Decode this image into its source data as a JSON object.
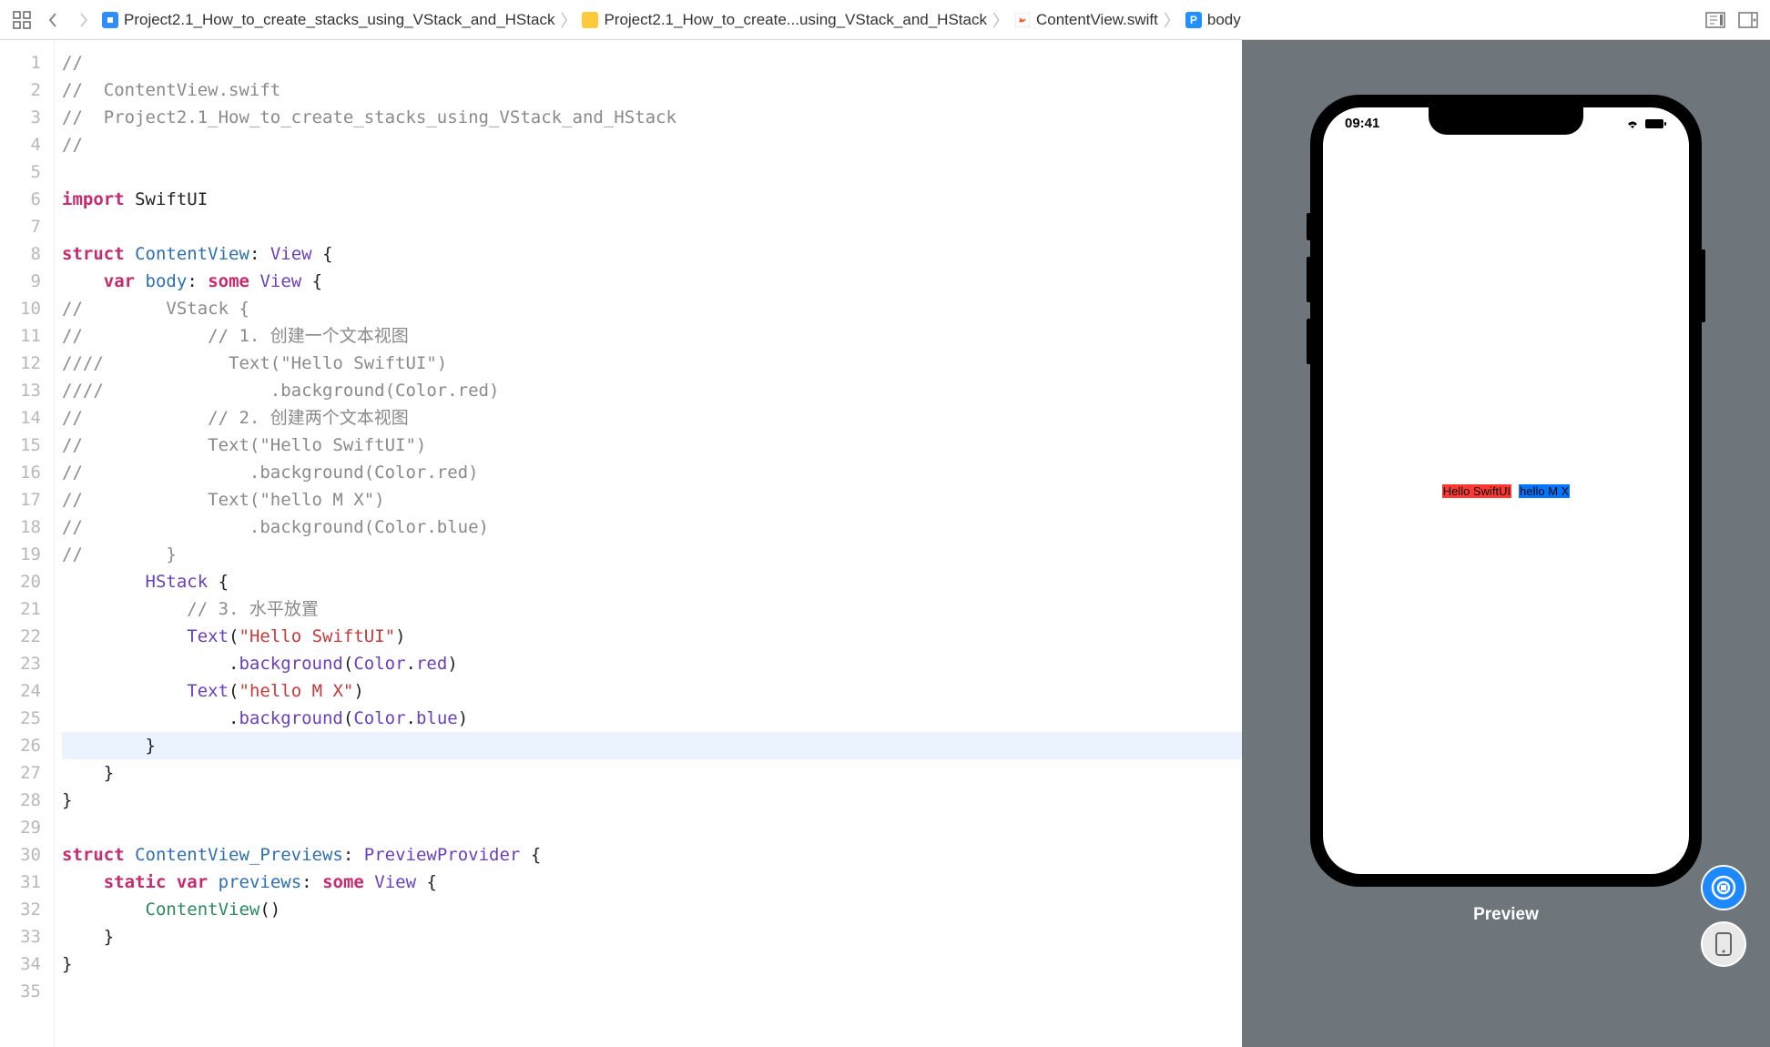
{
  "toolbar": {
    "breadcrumb": [
      {
        "icon": "project",
        "label": "Project2.1_How_to_create_stacks_using_VStack_and_HStack"
      },
      {
        "icon": "folder",
        "label": "Project2.1_How_to_create...using_VStack_and_HStack"
      },
      {
        "icon": "swift",
        "label": "ContentView.swift"
      },
      {
        "icon": "prop",
        "label": "body"
      }
    ]
  },
  "code": {
    "lines": [
      {
        "n": 1,
        "html": "<span class='c-comment'>//</span>"
      },
      {
        "n": 2,
        "html": "<span class='c-comment'>//  ContentView.swift</span>"
      },
      {
        "n": 3,
        "html": "<span class='c-comment'>//  Project2.1_How_to_create_stacks_using_VStack_and_HStack</span>"
      },
      {
        "n": 4,
        "html": "<span class='c-comment'>//</span>"
      },
      {
        "n": 5,
        "html": ""
      },
      {
        "n": 6,
        "html": "<span class='c-keyword'>import</span> <span class='c-plain'>SwiftUI</span>"
      },
      {
        "n": 7,
        "html": ""
      },
      {
        "n": 8,
        "html": "<span class='c-keyword'>struct</span> <span class='c-id'>ContentView</span><span class='c-plain'>:</span> <span class='c-type'>View</span> <span class='c-plain'>{</span>"
      },
      {
        "n": 9,
        "html": "    <span class='c-keyword'>var</span> <span class='c-id'>body</span><span class='c-plain'>:</span> <span class='c-keyword'>some</span> <span class='c-type'>View</span> <span class='c-plain'>{</span>"
      },
      {
        "n": 10,
        "html": "<span class='c-comment'>//        VStack {</span>"
      },
      {
        "n": 11,
        "html": "<span class='c-comment'>//            // 1. 创建一个文本视图</span>"
      },
      {
        "n": 12,
        "html": "<span class='c-comment'>////            Text(\"Hello SwiftUI\")</span>"
      },
      {
        "n": 13,
        "html": "<span class='c-comment'>////                .background(Color.red)</span>"
      },
      {
        "n": 14,
        "html": "<span class='c-comment'>//            // 2. 创建两个文本视图</span>"
      },
      {
        "n": 15,
        "html": "<span class='c-comment'>//            Text(\"Hello SwiftUI\")</span>"
      },
      {
        "n": 16,
        "html": "<span class='c-comment'>//                .background(Color.red)</span>"
      },
      {
        "n": 17,
        "html": "<span class='c-comment'>//            Text(\"hello M X\")</span>"
      },
      {
        "n": 18,
        "html": "<span class='c-comment'>//                .background(Color.blue)</span>"
      },
      {
        "n": 19,
        "html": "<span class='c-comment'>//        }</span>"
      },
      {
        "n": 20,
        "html": "        <span class='c-type'>HStack</span> <span class='c-plain'>{</span>"
      },
      {
        "n": 21,
        "html": "            <span class='c-comment'>// 3. 水平放置</span>"
      },
      {
        "n": 22,
        "html": "            <span class='c-type'>Text</span><span class='c-plain'>(</span><span class='c-string'>\"Hello SwiftUI\"</span><span class='c-plain'>)</span>"
      },
      {
        "n": 23,
        "html": "                <span class='c-plain'>.</span><span class='c-member'>background</span><span class='c-plain'>(</span><span class='c-type'>Color</span><span class='c-plain'>.</span><span class='c-member'>red</span><span class='c-plain'>)</span>"
      },
      {
        "n": 24,
        "html": "            <span class='c-type'>Text</span><span class='c-plain'>(</span><span class='c-string'>\"hello M X\"</span><span class='c-plain'>)</span>"
      },
      {
        "n": 25,
        "html": "                <span class='c-plain'>.</span><span class='c-member'>background</span><span class='c-plain'>(</span><span class='c-type'>Color</span><span class='c-plain'>.</span><span class='c-member'>blue</span><span class='c-plain'>)</span>"
      },
      {
        "n": 26,
        "html": "        <span class='c-plain'>}</span>",
        "hl": true
      },
      {
        "n": 27,
        "html": "    <span class='c-plain'>}</span>"
      },
      {
        "n": 28,
        "html": "<span class='c-plain'>}</span>"
      },
      {
        "n": 29,
        "html": ""
      },
      {
        "n": 30,
        "html": "<span class='c-keyword'>struct</span> <span class='c-id'>ContentView_Previews</span><span class='c-plain'>:</span> <span class='c-type'>PreviewProvider</span> <span class='c-plain'>{</span>"
      },
      {
        "n": 31,
        "html": "    <span class='c-keyword'>static</span> <span class='c-keyword'>var</span> <span class='c-id'>previews</span><span class='c-plain'>:</span> <span class='c-keyword'>some</span> <span class='c-type'>View</span> <span class='c-plain'>{</span>"
      },
      {
        "n": 32,
        "html": "        <span class='c-green'>ContentView</span><span class='c-plain'>()</span>"
      },
      {
        "n": 33,
        "html": "    <span class='c-plain'>}</span>"
      },
      {
        "n": 34,
        "html": "<span class='c-plain'>}</span>"
      },
      {
        "n": 35,
        "html": ""
      }
    ]
  },
  "preview": {
    "status_time": "09:41",
    "text1": "Hello SwiftUI",
    "text2": "hello M X",
    "label": "Preview"
  }
}
